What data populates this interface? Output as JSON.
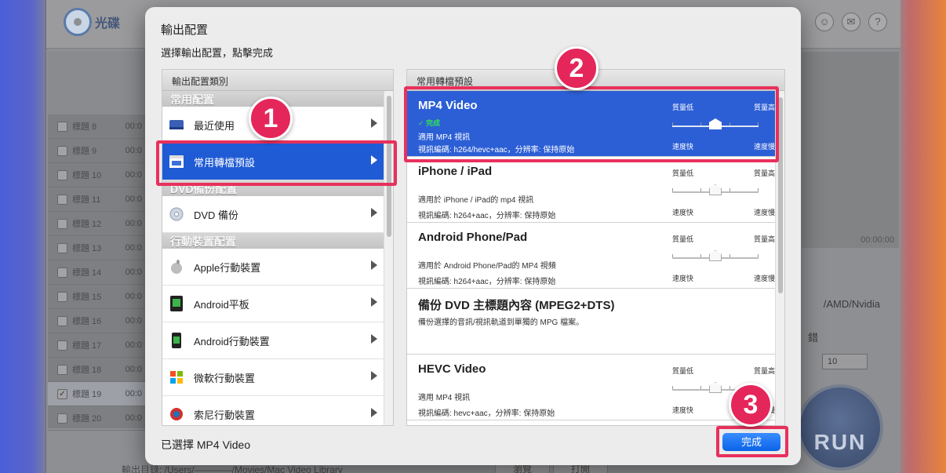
{
  "app": {
    "logo_text": "光碟",
    "logo_badge": "DVD",
    "titles": [
      {
        "label": "標題 8",
        "time": "00:0",
        "checked": false
      },
      {
        "label": "標題 9",
        "time": "00:0",
        "checked": false
      },
      {
        "label": "標題 10",
        "time": "00:0",
        "checked": false
      },
      {
        "label": "標題 11",
        "time": "00:0",
        "checked": false
      },
      {
        "label": "標題 12",
        "time": "00:0",
        "checked": false
      },
      {
        "label": "標題 13",
        "time": "00:0",
        "checked": false
      },
      {
        "label": "標題 14",
        "time": "00:0",
        "checked": false
      },
      {
        "label": "標題 15",
        "time": "00:0",
        "checked": false
      },
      {
        "label": "標題 16",
        "time": "00:0",
        "checked": false
      },
      {
        "label": "標題 17",
        "time": "00:0",
        "checked": false
      },
      {
        "label": "標題 18",
        "time": "00:0",
        "checked": false
      },
      {
        "label": "標題 19",
        "time": "00:0",
        "checked": true
      },
      {
        "label": "標題 20",
        "time": "00:0",
        "checked": false
      }
    ],
    "time_readout": "00:00:00",
    "gpu_label": "/AMD/Nvidia",
    "settings_label": "錯",
    "interval_value": "10",
    "run_label": "RUN",
    "output_dir": "輸出目錄:  /Users/————/Movies/Mac Video Library",
    "browse_label": "瀏覽",
    "open_label": "打開"
  },
  "dialog": {
    "title": "輸出配置",
    "subtitle": "選擇輸出配置，點擊完成",
    "left_header": "輸出配置類別",
    "right_header": "常用轉檔預設",
    "groups": {
      "common": "常用配置",
      "dvd": "DVD備份配置",
      "mobile": "行動裝置配置"
    },
    "categories": {
      "recent": "最近使用",
      "presets": "常用轉檔預設",
      "dvd_backup": "DVD 備份",
      "apple": "Apple行動裝置",
      "android_tablet": "Android平板",
      "android_mobile": "Android行動裝置",
      "microsoft": "微軟行動裝置",
      "sony": "索尼行動裝置"
    },
    "presets": [
      {
        "name": "MP4 Video",
        "check": "✓ 完成",
        "desc1": "適用 MP4 視訊",
        "desc2": "視訊編碼: h264/hevc+aac，分辨率: 保持原始",
        "q_low": "質量低",
        "q_high": "質量高",
        "s_fast": "速度快",
        "s_slow": "速度慢",
        "level": 0.5
      },
      {
        "name": "iPhone / iPad",
        "desc1": "適用於 iPhone / iPad的 mp4 視訊",
        "desc2": "視訊編碼: h264+aac，分辨率: 保持原始",
        "q_low": "質量低",
        "q_high": "質量高",
        "s_fast": "速度快",
        "s_slow": "速度慢",
        "level": 0.5
      },
      {
        "name": "Android Phone/Pad",
        "desc1": "適用於 Android Phone/Pad的 MP4 視頻",
        "desc2": "視訊編碼: h264+aac，分辨率: 保持原始",
        "q_low": "質量低",
        "q_high": "質量高",
        "s_fast": "速度快",
        "s_slow": "速度慢",
        "level": 0.5
      },
      {
        "name": "備份 DVD 主標題內容 (MPEG2+DTS)",
        "desc1": "備份選擇的音訊/視訊軌道到單獨的 MPG 檔案。"
      },
      {
        "name": "HEVC Video",
        "desc1": "適用 MP4 視訊",
        "desc2": "視訊編碼: hevc+aac，分辨率: 保持原始",
        "q_low": "質量低",
        "q_high": "質量高",
        "s_fast": "速度快",
        "s_slow": "速度慢",
        "level": 0.5
      }
    ],
    "selected_text": "已選擇 MP4 Video",
    "done_label": "完成"
  },
  "annotations": {
    "badge1": "1",
    "badge2": "2",
    "badge3": "3",
    "color": "#e8305c"
  }
}
